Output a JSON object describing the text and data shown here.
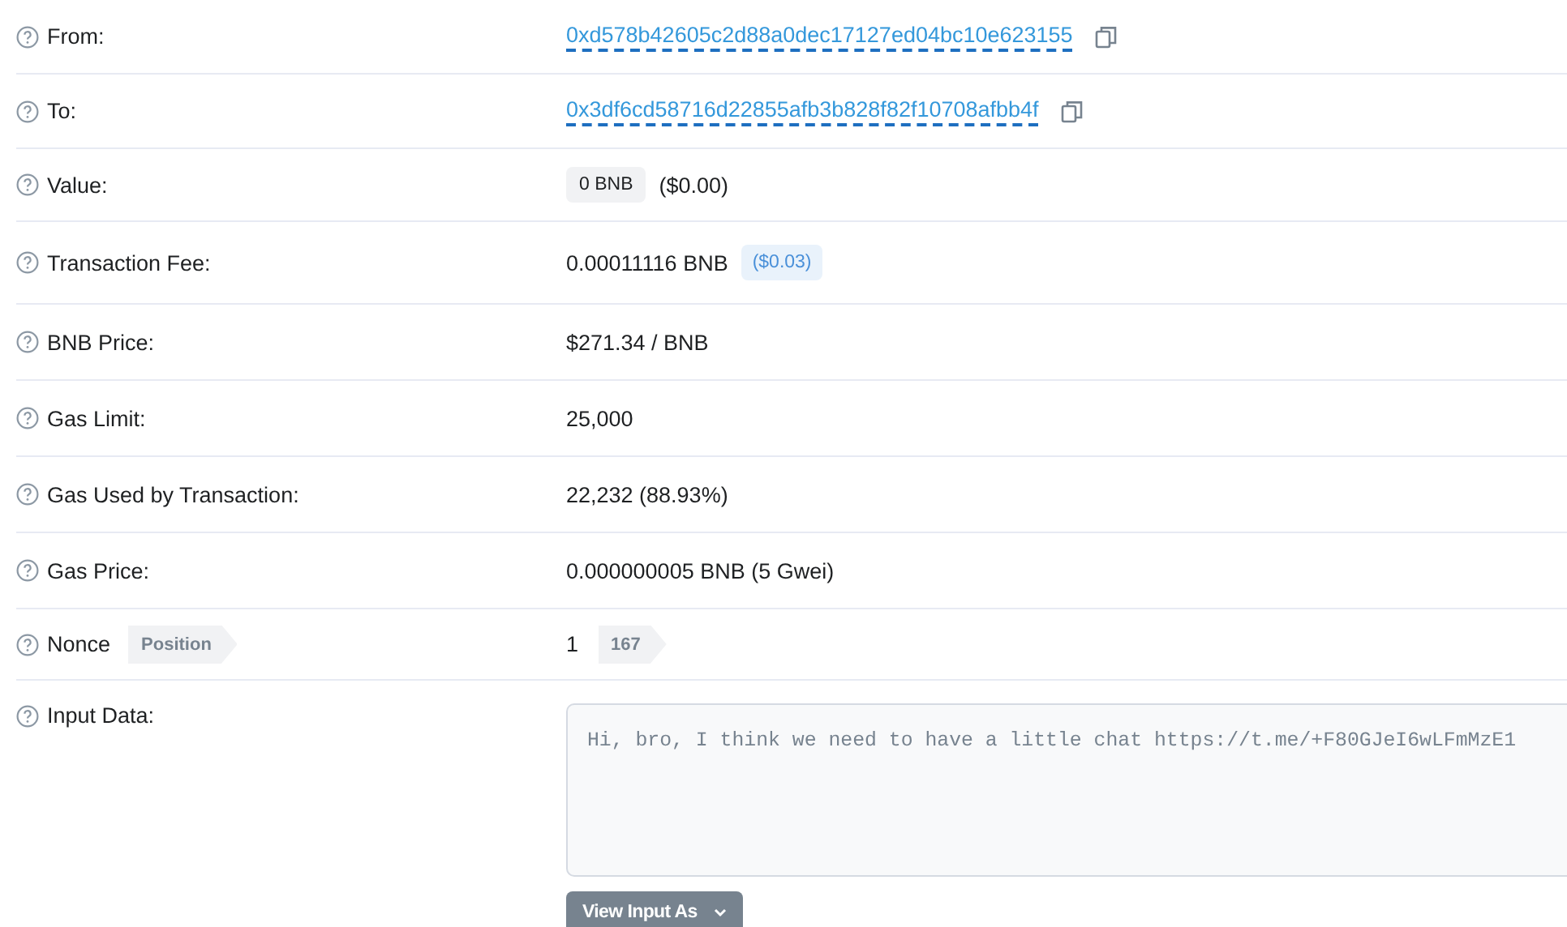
{
  "rows": [
    {
      "kind": "address",
      "label": "From:",
      "value": "0xd578b42605c2d88a0dec17127ed04bc10e623155"
    },
    {
      "kind": "address",
      "label": "To:",
      "value": "0x3df6cd58716d22855afb3b828f82f10708afbb4f"
    },
    {
      "kind": "value",
      "label": "Value:",
      "badge": "0 BNB",
      "value": "($0.00)"
    },
    {
      "kind": "fee",
      "label": "Transaction Fee:",
      "value": "0.00011116 BNB",
      "badge": "($0.03)"
    },
    {
      "kind": "text",
      "label": "BNB Price:",
      "value": "$271.34 / BNB"
    },
    {
      "kind": "text",
      "label": "Gas Limit:",
      "value": "25,000"
    },
    {
      "kind": "text",
      "label": "Gas Used by Transaction:",
      "value": "22,232 (88.93%)"
    },
    {
      "kind": "text",
      "label": "Gas Price:",
      "value": "0.000000005 BNB (5 Gwei)"
    },
    {
      "kind": "nonce",
      "label": "Nonce",
      "label_tag": "Position",
      "value": "1",
      "tag": "167"
    },
    {
      "kind": "input",
      "label": "Input Data:",
      "value": "Hi, bro, I think we need to have a little chat https://t.me/+F80GJeI6wLFmMzE1",
      "button": "View Input As"
    }
  ]
}
